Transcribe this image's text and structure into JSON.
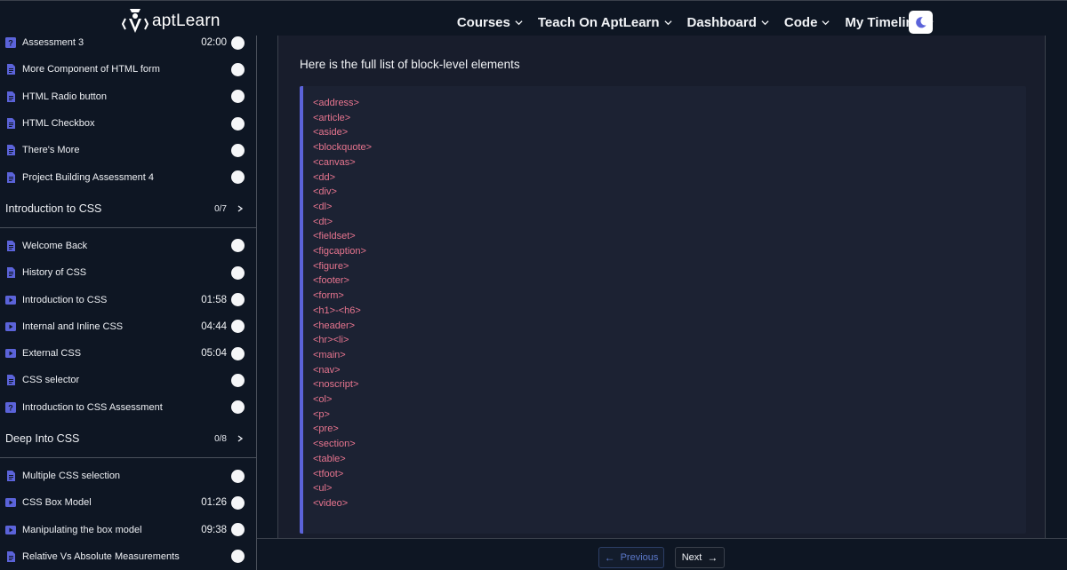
{
  "brand": {
    "name": "aptLearn"
  },
  "nav": {
    "items": [
      {
        "label": "Courses"
      },
      {
        "label": "Teach On AptLearn"
      },
      {
        "label": "Dashboard"
      },
      {
        "label": "Code"
      },
      {
        "label": "My Timeline"
      }
    ],
    "theme_icon": "moon-icon"
  },
  "sidebar": {
    "group1": [
      {
        "label": "Assessment 3",
        "duration": "02:00",
        "icon": "quiz-icon"
      },
      {
        "label": "More Component of HTML form",
        "duration": "",
        "icon": "document-icon"
      },
      {
        "label": "HTML Radio button",
        "duration": "",
        "icon": "document-icon"
      },
      {
        "label": "HTML Checkbox",
        "duration": "",
        "icon": "document-icon"
      },
      {
        "label": "There's More",
        "duration": "",
        "icon": "document-icon"
      },
      {
        "label": "Project Building Assessment 4",
        "duration": "",
        "icon": "document-icon"
      }
    ],
    "section1": {
      "title": "Introduction to CSS",
      "count": "0/7"
    },
    "group2": [
      {
        "label": "Welcome Back",
        "duration": "",
        "icon": "document-icon"
      },
      {
        "label": "History of CSS",
        "duration": "",
        "icon": "document-icon"
      },
      {
        "label": "Introduction to CSS",
        "duration": "01:58",
        "icon": "video-icon"
      },
      {
        "label": "Internal and Inline CSS",
        "duration": "04:44",
        "icon": "video-icon"
      },
      {
        "label": "External CSS",
        "duration": "05:04",
        "icon": "video-icon"
      },
      {
        "label": "CSS selector",
        "duration": "",
        "icon": "document-icon"
      },
      {
        "label": "Introduction to CSS Assessment",
        "duration": "",
        "icon": "quiz-icon"
      }
    ],
    "section2": {
      "title": "Deep Into CSS",
      "count": "0/8"
    },
    "group3": [
      {
        "label": "Multiple CSS selection",
        "duration": "",
        "icon": "document-icon"
      },
      {
        "label": "CSS Box Model",
        "duration": "01:26",
        "icon": "video-icon"
      },
      {
        "label": "Manipulating the box model",
        "duration": "09:38",
        "icon": "video-icon"
      },
      {
        "label": "Relative Vs Absolute Measurements",
        "duration": "",
        "icon": "document-icon"
      }
    ]
  },
  "content": {
    "intro": "Here is the full list of block-level elements",
    "code_lines": [
      "<address>",
      "<article>",
      "<aside>",
      "<blockquote>",
      "<canvas>",
      "<dd>",
      "<div>",
      "<dl>",
      "<dt>",
      "<fieldset>",
      "<figcaption>",
      "<figure>",
      "<footer>",
      "<form>",
      "<h1>-<h6>",
      "<header>",
      "<hr><li>",
      "<main>",
      "<nav>",
      "<noscript>",
      "<ol>",
      "<p>",
      "<pre>",
      "<section>",
      "<table>",
      "<tfoot>",
      "<ul>",
      "<video>"
    ]
  },
  "footer": {
    "prev_label": "Previous",
    "next_label": "Next"
  },
  "colors": {
    "accent": "#5b63d9",
    "code_text": "#e8758f",
    "background": "#0e1623"
  }
}
